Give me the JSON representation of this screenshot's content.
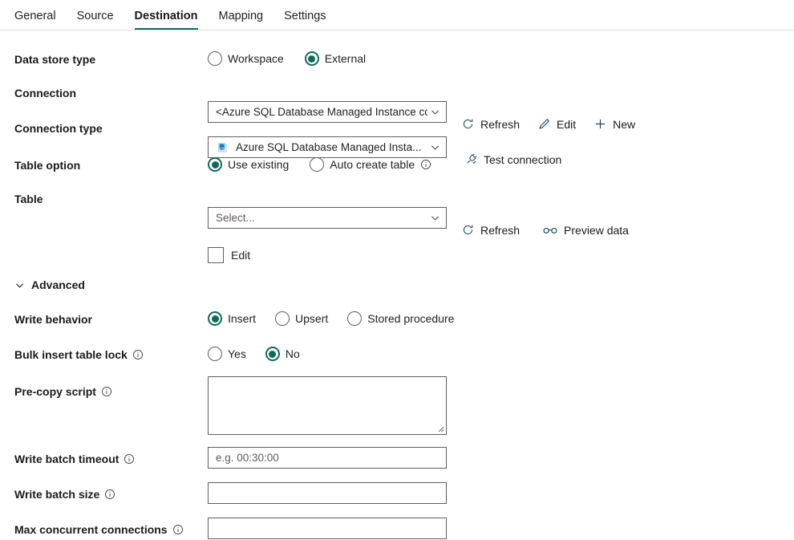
{
  "tabs": [
    {
      "label": "General",
      "active": false
    },
    {
      "label": "Source",
      "active": false
    },
    {
      "label": "Destination",
      "active": true
    },
    {
      "label": "Mapping",
      "active": false
    },
    {
      "label": "Settings",
      "active": false
    }
  ],
  "accent_color": "#0f6b5c",
  "form": {
    "data_store_type": {
      "label": "Data store type",
      "options": [
        {
          "label": "Workspace",
          "selected": false
        },
        {
          "label": "External",
          "selected": true
        }
      ]
    },
    "connection": {
      "label": "Connection",
      "value": "<Azure SQL Database Managed Instance connection>",
      "commands": [
        {
          "label": "Refresh",
          "icon": "refresh-icon"
        },
        {
          "label": "Edit",
          "icon": "pencil-icon"
        },
        {
          "label": "New",
          "icon": "plus-icon"
        }
      ]
    },
    "connection_type": {
      "label": "Connection type",
      "value": "Azure SQL Database Managed Insta...",
      "icon": "azure-sql-database-icon",
      "commands": [
        {
          "label": "Test connection",
          "icon": "plug-icon"
        }
      ]
    },
    "table_option": {
      "label": "Table option",
      "options": [
        {
          "label": "Use existing",
          "selected": true,
          "info": false
        },
        {
          "label": "Auto create table",
          "selected": false,
          "info": true
        }
      ]
    },
    "table": {
      "label": "Table",
      "placeholder": "Select...",
      "edit_checkbox_label": "Edit",
      "edit_checked": false,
      "commands": [
        {
          "label": "Refresh",
          "icon": "refresh-icon"
        },
        {
          "label": "Preview data",
          "icon": "glasses-icon"
        }
      ]
    },
    "advanced": {
      "label": "Advanced",
      "expanded": true
    },
    "write_behavior": {
      "label": "Write behavior",
      "options": [
        {
          "label": "Insert",
          "selected": true
        },
        {
          "label": "Upsert",
          "selected": false
        },
        {
          "label": "Stored procedure",
          "selected": false
        }
      ]
    },
    "bulk_insert_table_lock": {
      "label": "Bulk insert table lock",
      "info": true,
      "options": [
        {
          "label": "Yes",
          "selected": false
        },
        {
          "label": "No",
          "selected": true
        }
      ]
    },
    "pre_copy_script": {
      "label": "Pre-copy script",
      "info": true,
      "value": ""
    },
    "write_batch_timeout": {
      "label": "Write batch timeout",
      "info": true,
      "value": "",
      "placeholder": "e.g. 00:30:00"
    },
    "write_batch_size": {
      "label": "Write batch size",
      "info": true,
      "value": "",
      "placeholder": ""
    },
    "max_concurrent_connections": {
      "label": "Max concurrent connections",
      "info": true,
      "value": "",
      "placeholder": ""
    }
  }
}
